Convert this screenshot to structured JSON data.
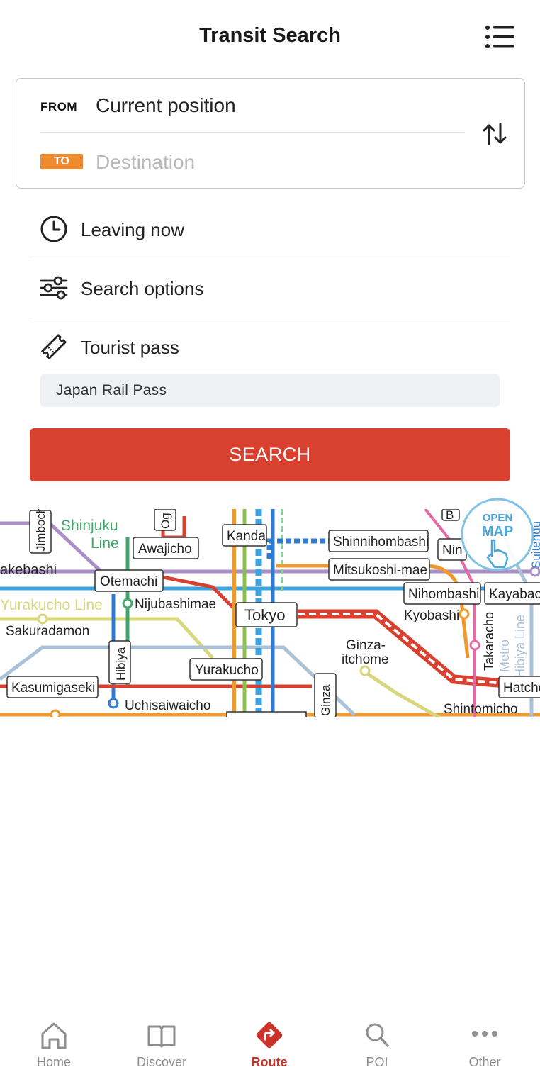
{
  "header": {
    "title": "Transit Search",
    "menu_icon": "list-menu-icon"
  },
  "route": {
    "from_tag": "FROM",
    "from_value": "Current position",
    "to_tag": "TO",
    "to_placeholder": "Destination",
    "to_value": "",
    "swap_icon": "swap-vertical-icon"
  },
  "options": [
    {
      "label": "Leaving now",
      "icon": "clock-icon"
    },
    {
      "label": "Search options",
      "icon": "sliders-icon"
    },
    {
      "label": "Tourist pass",
      "icon": "ticket-icon"
    }
  ],
  "tourist_pass": {
    "value": "Japan Rail Pass"
  },
  "search_button": {
    "label": "SEARCH",
    "color": "#d8402f"
  },
  "map": {
    "open_map_line1": "OPEN",
    "open_map_line2": "MAP",
    "labels": {
      "jimbocho": "Jimboch",
      "shinjuku_line1": "Shinjuku",
      "shinjuku_line2": "Line",
      "og": "Og",
      "awajicho": "Awajicho",
      "kanda": "Kanda",
      "shinnihombashi": "Shinnihombashi",
      "b": "B",
      "nin": "Nin",
      "suitengu": "Suitengu",
      "takebashi": "akebashi",
      "otemachi": "Otemachi",
      "mitsukoshimae": "Mitsukoshi-mae",
      "nihombashi": "Nihombashi",
      "kayabacho": "Kayabac",
      "yurakucho_line": "Yurakucho Line",
      "nijubashimae": "Nijubashimae",
      "tokyo": "Tokyo",
      "kyobashi": "Kyobashi",
      "sakuradamon": "Sakuradamon",
      "hibiya": "Hibiya",
      "ginza_itchome1": "Ginza-",
      "ginza_itchome2": "itchome",
      "takaracho": "Takaracho",
      "metro_hibiya1": "Metro",
      "metro_hibiya2": "Hibiya Line",
      "yurakucho": "Yurakucho",
      "kasumigaseki": "Kasumigaseki",
      "ginza": "Ginza",
      "hatchobori": "Hatcho",
      "uchisaiwaicho": "Uchisaiwaicho",
      "shintomicho": "Shintomicho"
    }
  },
  "tabs": [
    {
      "label": "Home",
      "icon": "home-icon"
    },
    {
      "label": "Discover",
      "icon": "book-icon"
    },
    {
      "label": "Route",
      "icon": "route-icon",
      "active": true
    },
    {
      "label": "POI",
      "icon": "search-icon"
    },
    {
      "label": "Other",
      "icon": "more-icon"
    }
  ],
  "colors": {
    "accent": "#d8402f",
    "to_tag": "#ef8a2e",
    "tab_active": "#c9332a",
    "tab_inactive": "#8e8e92"
  }
}
